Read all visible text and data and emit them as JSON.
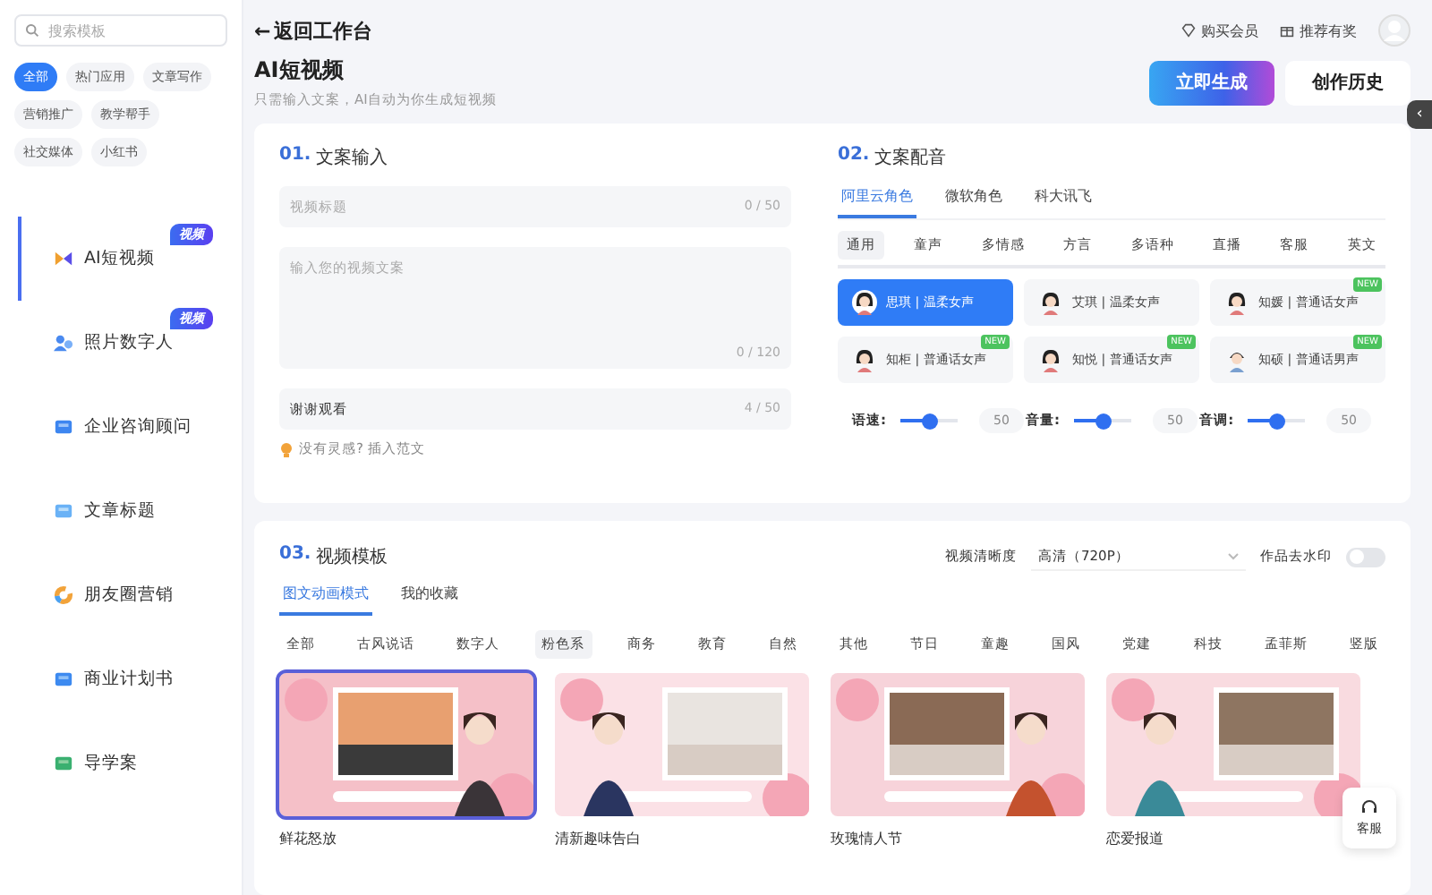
{
  "sidebar": {
    "search": {
      "placeholder": "搜索模板"
    },
    "categories": [
      {
        "label": "全部",
        "selected": true
      },
      {
        "label": "热门应用",
        "selected": false
      },
      {
        "label": "文章写作",
        "selected": false
      },
      {
        "label": "营销推广",
        "selected": false
      },
      {
        "label": "教学帮手",
        "selected": false
      },
      {
        "label": "社交媒体",
        "selected": false
      },
      {
        "label": "小红书",
        "selected": false
      }
    ],
    "items": [
      {
        "label": "AI短视频",
        "selected": true,
        "badge": "视频",
        "kind": "video"
      },
      {
        "label": "照片数字人",
        "selected": false,
        "badge": "视频",
        "kind": "person"
      },
      {
        "label": "企业咨询顾问",
        "selected": false,
        "kind": "consult"
      },
      {
        "label": "文章标题",
        "selected": false,
        "kind": "title"
      },
      {
        "label": "朋友圈营销",
        "selected": false,
        "kind": "ring"
      },
      {
        "label": "商业计划书",
        "selected": false,
        "kind": "plan"
      },
      {
        "label": "导学案",
        "selected": false,
        "kind": "guide"
      }
    ]
  },
  "header": {
    "back": "←",
    "back_label": "返回工作台",
    "links": [
      {
        "label": "购买会员",
        "kind": "diamond"
      },
      {
        "label": "推荐有奖",
        "kind": "gift"
      }
    ]
  },
  "page": {
    "title": "AI短视频",
    "subtitle": "只需输入文案，AI自动为你生成短视频",
    "primary": "立即生成",
    "secondary": "创作历史"
  },
  "copy_input": {
    "number": "01.",
    "title": "文案输入",
    "fields": [
      {
        "kind": "line",
        "placeholder": "视频标题",
        "count": "0 / 50"
      },
      {
        "kind": "area",
        "placeholder": "输入您的视频文案",
        "count": "0 / 120"
      },
      {
        "kind": "line",
        "value": "谢谢观看",
        "count": "4 / 50"
      }
    ],
    "tip": "没有灵感? 插入范文"
  },
  "dubbing": {
    "number": "02.",
    "title": "文案配音",
    "providers": [
      {
        "label": "阿里云角色",
        "selected": true
      },
      {
        "label": "微软角色",
        "selected": false
      },
      {
        "label": "科大讯飞",
        "selected": false
      }
    ],
    "categories": [
      {
        "label": "通用",
        "selected": true
      },
      {
        "label": "童声",
        "selected": false
      },
      {
        "label": "多情感",
        "selected": false
      },
      {
        "label": "方言",
        "selected": false
      },
      {
        "label": "多语种",
        "selected": false
      },
      {
        "label": "直播",
        "selected": false
      },
      {
        "label": "客服",
        "selected": false
      },
      {
        "label": "英文",
        "selected": false
      }
    ],
    "voices": [
      {
        "name": "思琪 | 温柔女声",
        "selected": true,
        "kind": "woman"
      },
      {
        "name": "艾琪 | 温柔女声",
        "selected": false,
        "kind": "woman"
      },
      {
        "name": "知媛 | 普通话女声",
        "selected": false,
        "tag": "NEW",
        "kind": "woman"
      },
      {
        "name": "知柜 | 普通话女声",
        "selected": false,
        "tag": "NEW",
        "kind": "woman"
      },
      {
        "name": "知悦 | 普通话女声",
        "selected": false,
        "tag": "NEW",
        "kind": "woman"
      },
      {
        "name": "知硕 | 普通话男声",
        "selected": false,
        "tag": "NEW",
        "kind": "man"
      }
    ],
    "sliders": [
      {
        "label": "语速:",
        "level": 0.5,
        "value": "50"
      },
      {
        "label": "音量:",
        "level": 0.5,
        "value": "50"
      },
      {
        "label": "音调:",
        "level": 0.5,
        "value": "50"
      }
    ]
  },
  "template": {
    "number": "03.",
    "title": "视频模板",
    "resolution_label": "视频清晰度",
    "resolution": "高清（720P）",
    "watermark_label": "作品去水印",
    "watermark_on": false,
    "tabs": [
      {
        "label": "图文动画模式",
        "selected": true
      },
      {
        "label": "我的收藏",
        "selected": false
      }
    ],
    "categories": [
      {
        "label": "全部",
        "selected": false
      },
      {
        "label": "古风说话",
        "selected": false
      },
      {
        "label": "数字人",
        "selected": false
      },
      {
        "label": "粉色系",
        "selected": true
      },
      {
        "label": "商务",
        "selected": false
      },
      {
        "label": "教育",
        "selected": false
      },
      {
        "label": "自然",
        "selected": false
      },
      {
        "label": "其他",
        "selected": false
      },
      {
        "label": "节日",
        "selected": false
      },
      {
        "label": "童趣",
        "selected": false
      },
      {
        "label": "国风",
        "selected": false
      },
      {
        "label": "党建",
        "selected": false
      },
      {
        "label": "科技",
        "selected": false
      },
      {
        "label": "孟菲斯",
        "selected": false
      },
      {
        "label": "竖版",
        "selected": false
      }
    ],
    "items": [
      {
        "title": "鲜花怒放",
        "selected": true
      },
      {
        "title": "清新趣味告白",
        "selected": false
      },
      {
        "title": "玫瑰情人节",
        "selected": false
      },
      {
        "title": "恋爱报道",
        "selected": false
      }
    ]
  },
  "service": {
    "label": "客服"
  },
  "collapse": "‹"
}
